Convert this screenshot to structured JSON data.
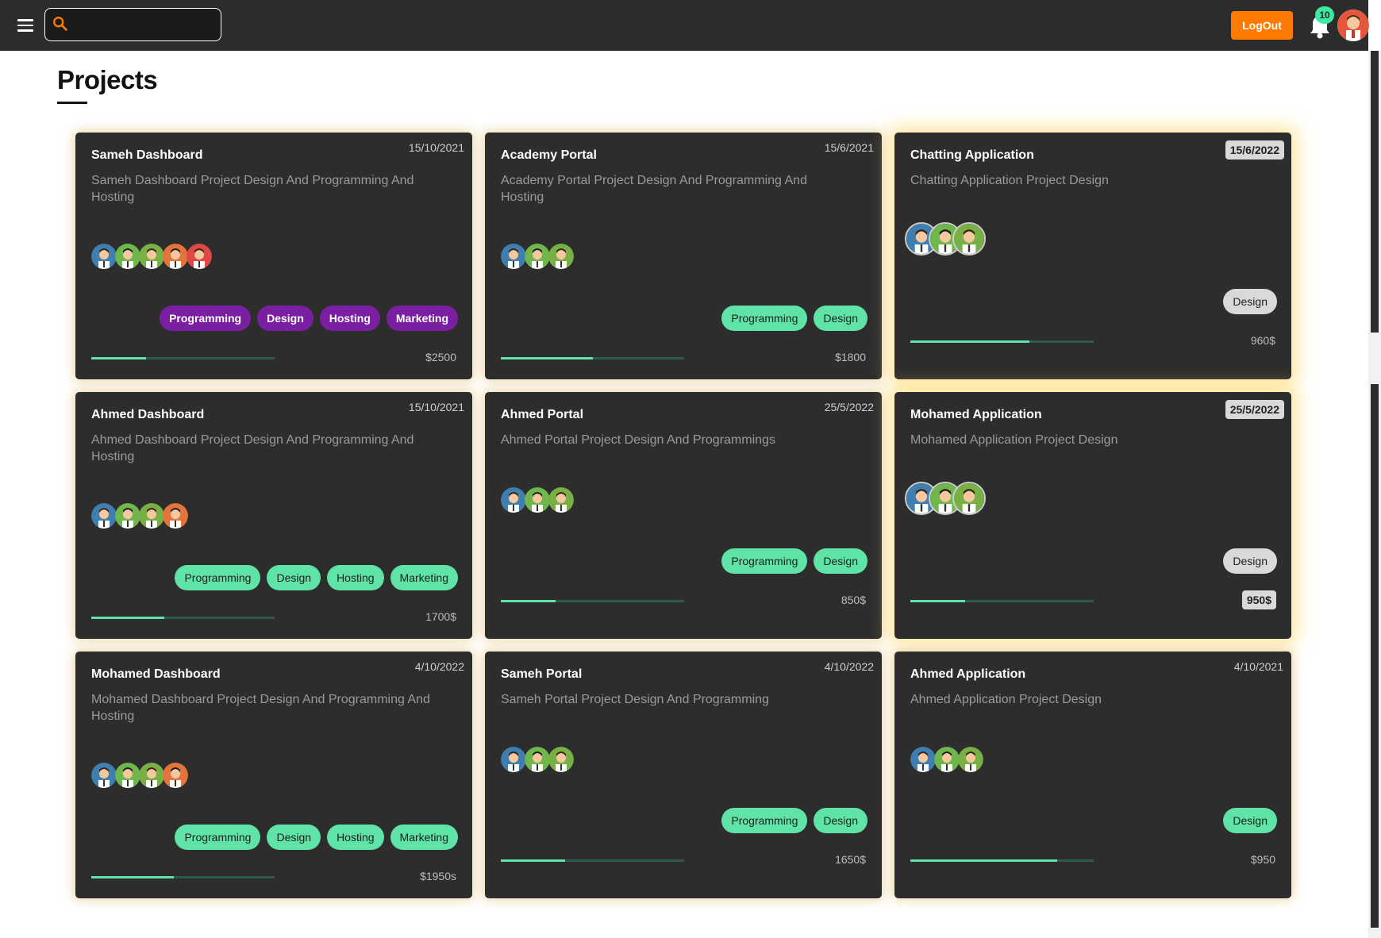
{
  "header": {
    "search_placeholder": "",
    "logout_label": "LogOut",
    "notification_count": "10"
  },
  "page": {
    "title": "Projects"
  },
  "colors": {
    "topbar": "#2c2c2c",
    "accent": "#ff7a00",
    "tag_green": "#5fe3a6",
    "tag_purple": "#7b1fa2",
    "card_bg": "#2d2d2d"
  },
  "projects": [
    {
      "title": "Sameh Dashboard",
      "date": "15/10/2021",
      "description": "Sameh Dashboard Project Design And Programming And Hosting",
      "members": 5,
      "tags": [
        "Programming",
        "Design",
        "Hosting",
        "Marketing"
      ],
      "progress": 0.3,
      "price": "$2500"
    },
    {
      "title": "Academy Portal",
      "date": "15/6/2021",
      "description": "Academy Portal Project Design And Programming And Hosting",
      "members": 3,
      "tags": [
        "Programming",
        "Design"
      ],
      "progress": 0.5,
      "price": "$1800"
    },
    {
      "title": "Chatting Application",
      "date": "15/6/2022",
      "description": "Chatting Application Project Design",
      "members": 3,
      "tags": [
        "Design"
      ],
      "progress": 0.65,
      "price": "960$"
    },
    {
      "title": "Ahmed Dashboard",
      "date": "15/10/2021",
      "description": "Ahmed Dashboard Project Design And Programming And Hosting",
      "members": 4,
      "tags": [
        "Programming",
        "Design",
        "Hosting",
        "Marketing"
      ],
      "progress": 0.4,
      "price": "1700$"
    },
    {
      "title": "Ahmed Portal",
      "date": "25/5/2022",
      "description": "Ahmed Portal Project Design And Programmings",
      "members": 3,
      "tags": [
        "Programming",
        "Design"
      ],
      "progress": 0.3,
      "price": "850$"
    },
    {
      "title": "Mohamed Application",
      "date": "25/5/2022",
      "description": "Mohamed Application Project Design",
      "members": 3,
      "tags": [
        "Design"
      ],
      "progress": 0.3,
      "price": "950$"
    },
    {
      "title": "Mohamed Dashboard",
      "date": "4/10/2022",
      "description": "Mohamed Dashboard Project Design And Programming And Hosting",
      "members": 4,
      "tags": [
        "Programming",
        "Design",
        "Hosting",
        "Marketing"
      ],
      "progress": 0.45,
      "price": "$1950s"
    },
    {
      "title": "Sameh Portal",
      "date": "4/10/2022",
      "description": "Sameh Portal Project Design And Programming",
      "members": 3,
      "tags": [
        "Programming",
        "Design"
      ],
      "progress": 0.35,
      "price": "1650$"
    },
    {
      "title": "Ahmed Application",
      "date": "4/10/2021",
      "description": "Ahmed Application Project Design",
      "members": 3,
      "tags": [
        "Design"
      ],
      "progress": 0.8,
      "price": "$950"
    }
  ]
}
